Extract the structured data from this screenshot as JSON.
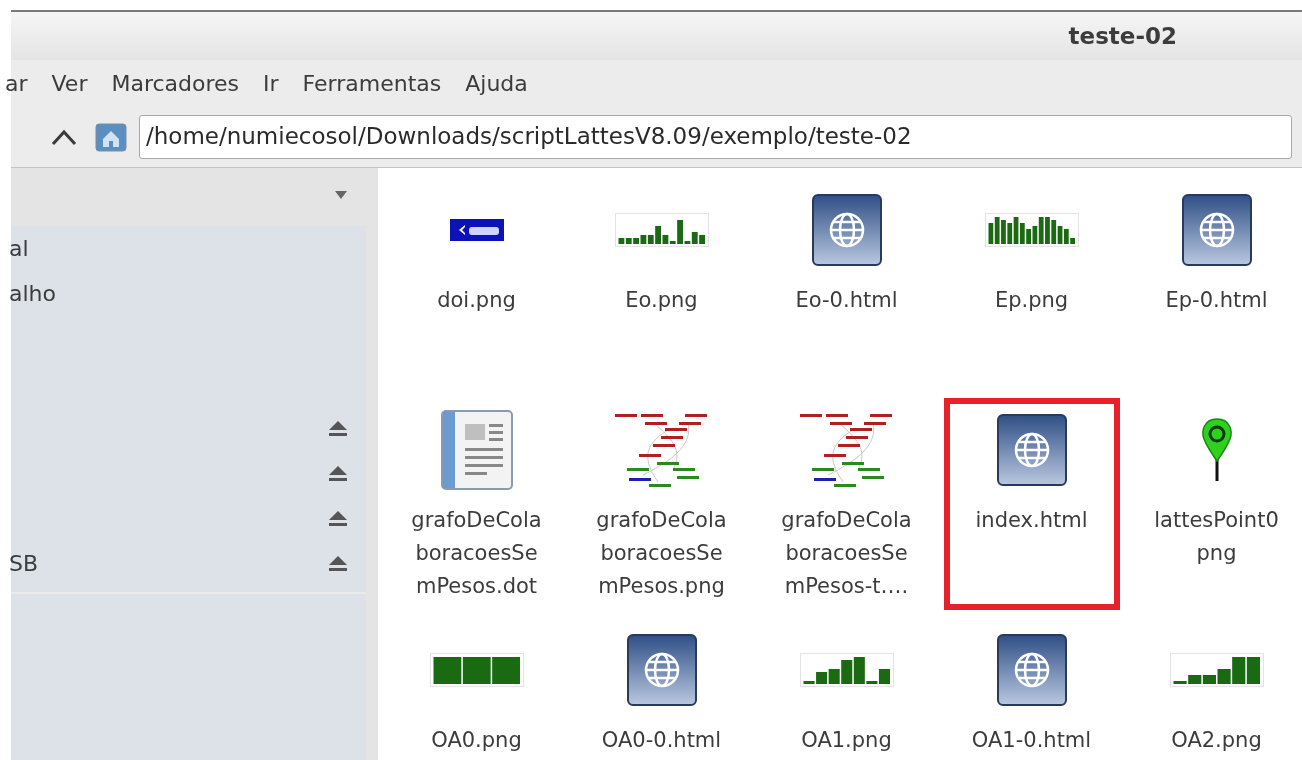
{
  "window": {
    "title": "teste-02"
  },
  "menu": [
    "ar",
    "Ver",
    "Marcadores",
    "Ir",
    "Ferramentas",
    "Ajuda"
  ],
  "location": {
    "value": "/home/numiecosol/Downloads/scriptLattesV8.09/exemplo/teste-02"
  },
  "sidebar": {
    "items": [
      {
        "label": "al",
        "ejectable": false
      },
      {
        "label": "alho",
        "ejectable": false
      },
      {
        "ejectable": false
      },
      {
        "ejectable": false
      },
      {
        "ejectable": true
      },
      {
        "ejectable": true
      },
      {
        "ejectable": true
      },
      {
        "label": "SB",
        "ejectable": true
      }
    ]
  },
  "files": [
    {
      "kind": "doi",
      "lines": [
        "doi.png"
      ],
      "highlighted": false
    },
    {
      "kind": "bars",
      "lines": [
        "Eo.png"
      ],
      "highlighted": false
    },
    {
      "kind": "web",
      "lines": [
        "Eo-0.html"
      ],
      "highlighted": false
    },
    {
      "kind": "bars",
      "lines": [
        "Ep.png"
      ],
      "highlighted": false
    },
    {
      "kind": "web",
      "lines": [
        "Ep-0.html"
      ],
      "highlighted": false
    },
    {
      "kind": "document",
      "lines": [
        "grafoDeCola",
        "boracoesSe",
        "mPesos.dot"
      ],
      "highlighted": false
    },
    {
      "kind": "graph",
      "lines": [
        "grafoDeCola",
        "boracoesSe",
        "mPesos.png"
      ],
      "highlighted": false
    },
    {
      "kind": "graph",
      "lines": [
        "grafoDeCola",
        "boracoesSe",
        "mPesos-t…."
      ],
      "highlighted": false
    },
    {
      "kind": "web",
      "lines": [
        "index.html"
      ],
      "highlighted": true
    },
    {
      "kind": "pin",
      "lines": [
        "lattesPoint0",
        "png"
      ],
      "highlighted": false
    },
    {
      "kind": "bars",
      "lines": [
        "OA0.png"
      ],
      "highlighted": false
    },
    {
      "kind": "web",
      "lines": [
        "OA0-0.html"
      ],
      "highlighted": false
    },
    {
      "kind": "bars",
      "lines": [
        "OA1.png"
      ],
      "highlighted": false
    },
    {
      "kind": "web",
      "lines": [
        "OA1-0.html"
      ],
      "highlighted": false
    },
    {
      "kind": "bars",
      "lines": [
        "OA2.png"
      ],
      "highlighted": false
    }
  ]
}
